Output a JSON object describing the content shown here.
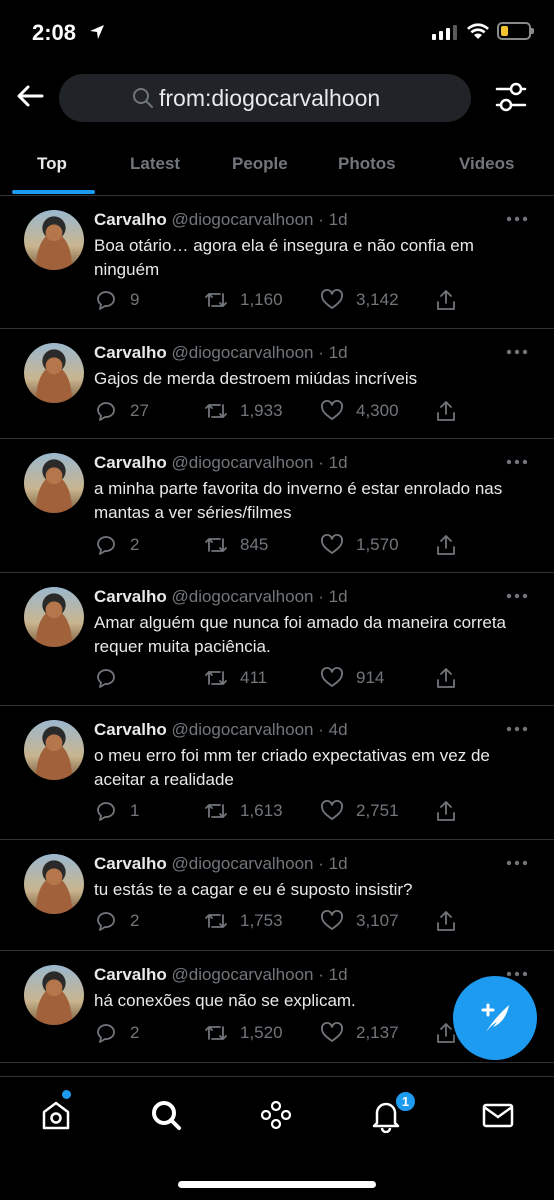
{
  "status": {
    "time": "2:08"
  },
  "search": {
    "query": "from:diogocarvalhoon"
  },
  "tabs": [
    "Top",
    "Latest",
    "People",
    "Photos",
    "Videos"
  ],
  "tweets": [
    {
      "name": "Carvalho",
      "handle": "@diogocarvalhoon",
      "dot": "·",
      "ago": "1d",
      "text": "Boa otário… agora ela é insegura e não confia em ninguém",
      "replies": "9",
      "retweets": "1,160",
      "likes": "3,142"
    },
    {
      "name": "Carvalho",
      "handle": "@diogocarvalhoon",
      "dot": "·",
      "ago": "1d",
      "text": "Gajos de merda destroem miúdas incríveis",
      "replies": "27",
      "retweets": "1,933",
      "likes": "4,300"
    },
    {
      "name": "Carvalho",
      "handle": "@diogocarvalhoon",
      "dot": "·",
      "ago": "1d",
      "text": "a minha parte favorita do inverno é estar enrolado nas mantas a ver séries/filmes",
      "replies": "2",
      "retweets": "845",
      "likes": "1,570"
    },
    {
      "name": "Carvalho",
      "handle": "@diogocarvalhoon",
      "dot": "·",
      "ago": "1d",
      "text": "Amar alguém que nunca foi amado da maneira correta requer muita paciência.",
      "replies": "",
      "retweets": "411",
      "likes": "914"
    },
    {
      "name": "Carvalho",
      "handle": "@diogocarvalhoon",
      "dot": "·",
      "ago": "4d",
      "text": "o meu erro foi mm ter criado expectativas em vez de aceitar a realidade",
      "replies": "1",
      "retweets": "1,613",
      "likes": "2,751"
    },
    {
      "name": "Carvalho",
      "handle": "@diogocarvalhoon",
      "dot": "·",
      "ago": "1d",
      "text": "tu estás te a cagar e eu é suposto insistir?",
      "replies": "2",
      "retweets": "1,753",
      "likes": "3,107"
    },
    {
      "name": "Carvalho",
      "handle": "@diogocarvalhoon",
      "dot": "·",
      "ago": "1d",
      "text": "há conexões que não se explicam.",
      "replies": "2",
      "retweets": "1,520",
      "likes": "2,137"
    }
  ],
  "nav": {
    "notifications_badge": "1"
  },
  "icons": {
    "status": [
      "location-arrow-icon",
      "signal-icon",
      "wifi-icon",
      "battery-icon"
    ],
    "header": [
      "back-arrow-icon",
      "search-icon",
      "filter-sliders-icon"
    ],
    "tweet_actions": [
      "reply-icon",
      "retweet-icon",
      "like-icon",
      "share-icon"
    ],
    "nav": [
      "home-icon",
      "explore-icon",
      "spaces-icon",
      "notifications-icon",
      "messages-icon"
    ],
    "fab": "compose-tweet-icon"
  },
  "colors": {
    "accent": "#1d9bf0",
    "background": "#000000",
    "muted": "#71767b",
    "text": "#e7e9ea"
  }
}
